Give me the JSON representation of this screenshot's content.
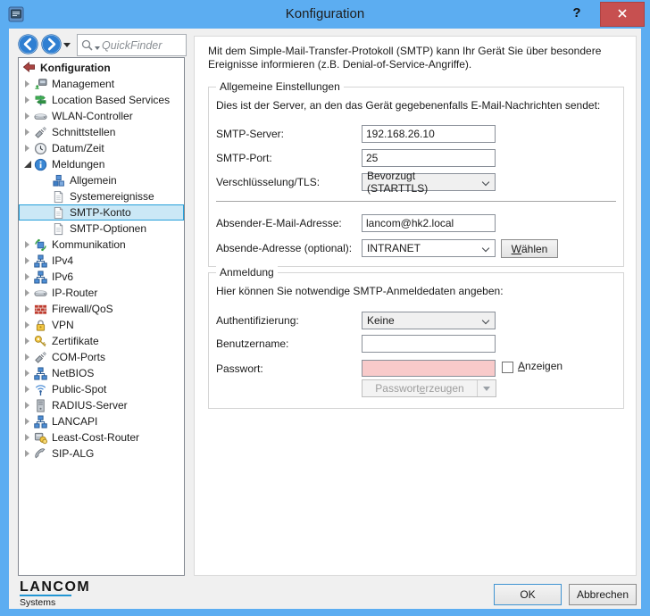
{
  "window": {
    "title": "Konfiguration",
    "help_label": "?"
  },
  "toolbar": {
    "quickfinder_placeholder": "QuickFinder"
  },
  "tree": {
    "items": [
      {
        "label": "Konfiguration",
        "icon": "config-arrow-icon",
        "depth": 0,
        "state": "root",
        "bold": true,
        "selected": false
      },
      {
        "label": "Management",
        "icon": "management-icon",
        "depth": 1,
        "state": "collapsed",
        "bold": false,
        "selected": false
      },
      {
        "label": "Location Based Services",
        "icon": "signpost-icon",
        "depth": 1,
        "state": "collapsed",
        "bold": false,
        "selected": false
      },
      {
        "label": "WLAN-Controller",
        "icon": "device-icon",
        "depth": 1,
        "state": "collapsed",
        "bold": false,
        "selected": false
      },
      {
        "label": "Schnittstellen",
        "icon": "connector-icon",
        "depth": 1,
        "state": "collapsed",
        "bold": false,
        "selected": false
      },
      {
        "label": "Datum/Zeit",
        "icon": "clock-icon",
        "depth": 1,
        "state": "collapsed",
        "bold": false,
        "selected": false
      },
      {
        "label": "Meldungen",
        "icon": "info-icon",
        "depth": 1,
        "state": "expanded",
        "bold": false,
        "selected": false
      },
      {
        "label": "Allgemein",
        "icon": "cubes-icon",
        "depth": 2,
        "state": "leaf",
        "bold": false,
        "selected": false
      },
      {
        "label": "Systemereignisse",
        "icon": "document-icon",
        "depth": 2,
        "state": "leaf",
        "bold": false,
        "selected": false
      },
      {
        "label": "SMTP-Konto",
        "icon": "document-icon",
        "depth": 2,
        "state": "leaf",
        "bold": false,
        "selected": true
      },
      {
        "label": "SMTP-Optionen",
        "icon": "document-icon",
        "depth": 2,
        "state": "leaf",
        "bold": false,
        "selected": false
      },
      {
        "label": "Kommunikation",
        "icon": "comm-icon",
        "depth": 1,
        "state": "collapsed",
        "bold": false,
        "selected": false
      },
      {
        "label": "IPv4",
        "icon": "network-icon",
        "depth": 1,
        "state": "collapsed",
        "bold": false,
        "selected": false
      },
      {
        "label": "IPv6",
        "icon": "network-icon",
        "depth": 1,
        "state": "collapsed",
        "bold": false,
        "selected": false
      },
      {
        "label": "IP-Router",
        "icon": "device-icon",
        "depth": 1,
        "state": "collapsed",
        "bold": false,
        "selected": false
      },
      {
        "label": "Firewall/QoS",
        "icon": "firewall-icon",
        "depth": 1,
        "state": "collapsed",
        "bold": false,
        "selected": false
      },
      {
        "label": "VPN",
        "icon": "lock-icon",
        "depth": 1,
        "state": "collapsed",
        "bold": false,
        "selected": false
      },
      {
        "label": "Zertifikate",
        "icon": "key-icon",
        "depth": 1,
        "state": "collapsed",
        "bold": false,
        "selected": false
      },
      {
        "label": "COM-Ports",
        "icon": "connector-icon",
        "depth": 1,
        "state": "collapsed",
        "bold": false,
        "selected": false
      },
      {
        "label": "NetBIOS",
        "icon": "network-icon",
        "depth": 1,
        "state": "collapsed",
        "bold": false,
        "selected": false
      },
      {
        "label": "Public-Spot",
        "icon": "wifi-icon",
        "depth": 1,
        "state": "collapsed",
        "bold": false,
        "selected": false
      },
      {
        "label": "RADIUS-Server",
        "icon": "server-icon",
        "depth": 1,
        "state": "collapsed",
        "bold": false,
        "selected": false
      },
      {
        "label": "LANCAPI",
        "icon": "network-icon",
        "depth": 1,
        "state": "collapsed",
        "bold": false,
        "selected": false
      },
      {
        "label": "Least-Cost-Router",
        "icon": "coins-icon",
        "depth": 1,
        "state": "collapsed",
        "bold": false,
        "selected": false
      },
      {
        "label": "SIP-ALG",
        "icon": "phone-icon",
        "depth": 1,
        "state": "collapsed",
        "bold": false,
        "selected": false
      }
    ]
  },
  "main": {
    "intro": "Mit dem Simple-Mail-Transfer-Protokoll (SMTP) kann Ihr Gerät Sie über besondere Ereignisse informieren (z.B. Denial-of-Service-Angriffe).",
    "general": {
      "legend": "Allgemeine Einstellungen",
      "description": "Dies ist der Server, an den das Gerät gegebenenfalls E-Mail-Nachrichten sendet:",
      "smtp_server": {
        "label": "SMTP-Server:",
        "value": "192.168.26.10"
      },
      "smtp_port": {
        "label": "SMTP-Port:",
        "value": "25"
      },
      "tls": {
        "label": "Verschlüsselung/TLS:",
        "value": "Bevorzugt (STARTTLS)"
      },
      "sender_email": {
        "label": "Absender-E-Mail-Adresse:",
        "value": "lancom@hk2.local"
      },
      "sender_address": {
        "label": "Absende-Adresse (optional):",
        "value": "INTRANET"
      },
      "choose_button": {
        "label": "Wählen",
        "accel_index": 0
      }
    },
    "login": {
      "legend": "Anmeldung",
      "description": "Hier können Sie notwendige SMTP-Anmeldedaten angeben:",
      "auth": {
        "label": "Authentifizierung:",
        "value": "Keine"
      },
      "username": {
        "label": "Benutzername:",
        "value": ""
      },
      "password": {
        "label": "Passwort:",
        "value": "",
        "highlighted": true
      },
      "show_checkbox": {
        "label": "Anzeigen",
        "accel_index": 0,
        "checked": false
      },
      "generate_button": {
        "label": "Passwort erzeugen",
        "accel_index": 9,
        "disabled": true
      }
    }
  },
  "footer": {
    "logo_line1": "LANCOM",
    "logo_line2": "Systems",
    "ok_label": "OK",
    "cancel_label": "Abbrechen"
  },
  "colors": {
    "titlebar": "#5cadf1",
    "close_button": "#c75050",
    "tree_selection_bg": "#cbe8f6",
    "tree_selection_border": "#26a0da",
    "password_highlight": "#f8caca",
    "logo_underline": "#2196d4"
  }
}
